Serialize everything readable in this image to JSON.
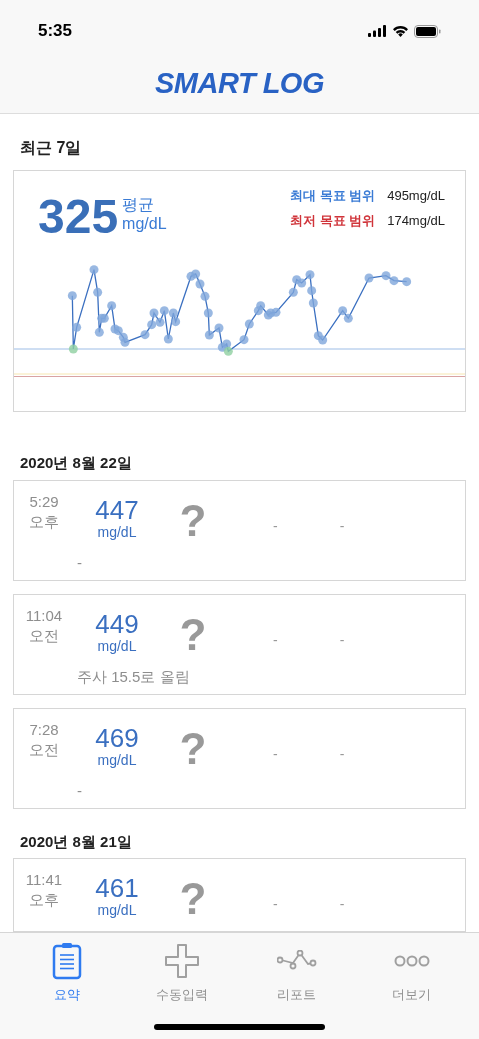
{
  "status_bar": {
    "time": "5:35"
  },
  "header": {
    "logo": "SMART LOG"
  },
  "summary": {
    "title": "최근 7일",
    "average": "325",
    "average_label": "평균",
    "unit": "mg/dL",
    "ranges": [
      {
        "label": "최대 목표 범위",
        "value": "495mg/dL",
        "color": "#3a7bd5"
      },
      {
        "label": "최저 목표 범위",
        "value": "174mg/dL",
        "color": "#d0343a"
      }
    ]
  },
  "days": [
    {
      "date": "2020년 8월 22일",
      "entries": [
        {
          "time": "5:29",
          "period": "오후",
          "value": "447",
          "unit": "mg/dL",
          "meal": "?",
          "column_4": "-",
          "column_5": "-",
          "note": "-"
        },
        {
          "time": "11:04",
          "period": "오전",
          "value": "449",
          "unit": "mg/dL",
          "meal": "?",
          "column_4": "-",
          "column_5": "-",
          "note": "주사 15.5로 올림"
        },
        {
          "time": "7:28",
          "period": "오전",
          "value": "469",
          "unit": "mg/dL",
          "meal": "?",
          "column_4": "-",
          "column_5": "-",
          "note": "-"
        }
      ]
    },
    {
      "date": "2020년 8월 21일",
      "entries": [
        {
          "time": "11:41",
          "period": "오후",
          "value": "461",
          "unit": "mg/dL",
          "meal": "?",
          "column_4": "-",
          "column_5": "-"
        }
      ]
    }
  ],
  "tabs": [
    {
      "label": "요약",
      "selected": true
    },
    {
      "label": "수동입력",
      "selected": false
    },
    {
      "label": "리포트",
      "selected": false
    },
    {
      "label": "더보기",
      "selected": false
    }
  ]
}
